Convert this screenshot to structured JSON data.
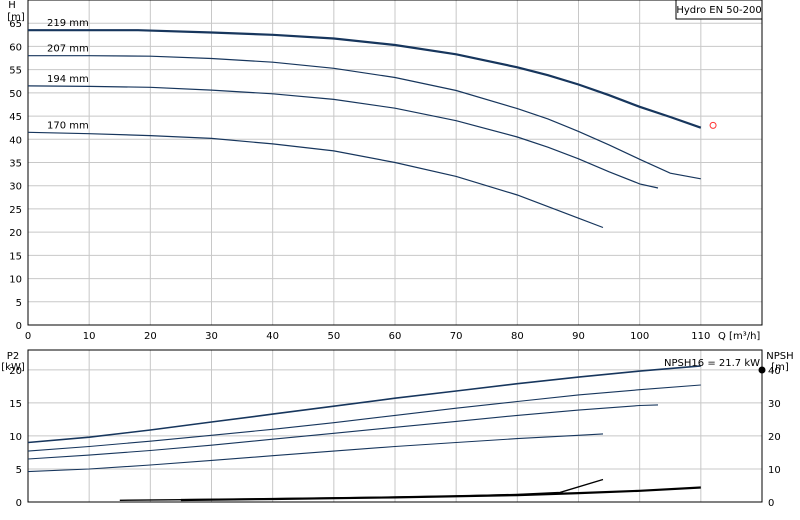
{
  "chart_data": [
    {
      "type": "line",
      "title": "Hydro EN 50-200",
      "ylabel": "H",
      "yunit": "[m]",
      "xlabel": "Q [m³/h]",
      "xlim": [
        0,
        120
      ],
      "ylim": [
        0,
        70
      ],
      "xticks": [
        "0",
        "10",
        "20",
        "30",
        "40",
        "50",
        "60",
        "70",
        "80",
        "90",
        "100",
        "110"
      ],
      "yticks": [
        "0",
        "5",
        "10",
        "15",
        "20",
        "25",
        "30",
        "35",
        "40",
        "45",
        "50",
        "55",
        "60",
        "65"
      ],
      "grid": true,
      "duty_point": {
        "x": 112,
        "y": 43
      },
      "series": [
        {
          "name": "219 mm",
          "emphasis": true,
          "x": [
            0,
            18,
            30,
            40,
            50,
            60,
            70,
            80,
            85,
            90,
            95,
            100,
            105,
            110
          ],
          "y": [
            63.5,
            63.5,
            63.0,
            62.5,
            61.7,
            60.3,
            58.3,
            55.5,
            53.8,
            51.8,
            49.5,
            47.0,
            44.8,
            42.5
          ]
        },
        {
          "name": "207 mm",
          "emphasis": false,
          "x": [
            0,
            10,
            20,
            30,
            40,
            50,
            60,
            70,
            80,
            85,
            90,
            95,
            100,
            105,
            110
          ],
          "y": [
            58.0,
            58.0,
            57.9,
            57.4,
            56.6,
            55.3,
            53.3,
            50.5,
            46.6,
            44.4,
            41.7,
            38.8,
            35.7,
            32.7,
            31.5
          ]
        },
        {
          "name": "194 mm",
          "emphasis": false,
          "x": [
            0,
            10,
            20,
            30,
            40,
            50,
            60,
            70,
            80,
            85,
            90,
            95,
            100,
            103
          ],
          "y": [
            51.5,
            51.4,
            51.2,
            50.6,
            49.8,
            48.6,
            46.7,
            44.0,
            40.5,
            38.3,
            35.8,
            33.0,
            30.4,
            29.5
          ]
        },
        {
          "name": "170 mm",
          "emphasis": false,
          "x": [
            0,
            10,
            20,
            30,
            40,
            50,
            60,
            70,
            80,
            85,
            90,
            94
          ],
          "y": [
            41.5,
            41.2,
            40.8,
            40.2,
            39.0,
            37.5,
            35.0,
            32.0,
            28.0,
            25.5,
            23.0,
            21.0
          ]
        }
      ]
    },
    {
      "type": "line",
      "ylabel": "P2",
      "yunit": "[kW]",
      "y2label": "NPSH",
      "y2unit": "[m]",
      "annotation": "NPSH16 = 21.7 kW",
      "xlim": [
        0,
        120
      ],
      "ylim": [
        0,
        23
      ],
      "y2lim": [
        0,
        46
      ],
      "yticks": [
        "0",
        "5",
        "10",
        "15",
        "20"
      ],
      "y2ticks": [
        "0",
        "10",
        "20",
        "30",
        "40"
      ],
      "grid": true,
      "power_series": [
        {
          "x": [
            0,
            10,
            20,
            30,
            40,
            50,
            60,
            70,
            80,
            90,
            100,
            110
          ],
          "y": [
            9.0,
            9.8,
            10.9,
            12.1,
            13.3,
            14.5,
            15.7,
            16.8,
            17.9,
            18.9,
            19.8,
            20.6
          ]
        },
        {
          "x": [
            0,
            10,
            20,
            30,
            40,
            50,
            60,
            70,
            80,
            90,
            100,
            110
          ],
          "y": [
            7.7,
            8.4,
            9.2,
            10.1,
            11.0,
            12.0,
            13.1,
            14.2,
            15.2,
            16.2,
            17.0,
            17.7
          ]
        },
        {
          "x": [
            0,
            10,
            20,
            30,
            40,
            50,
            60,
            70,
            80,
            90,
            100,
            103
          ],
          "y": [
            6.5,
            7.1,
            7.8,
            8.6,
            9.5,
            10.4,
            11.3,
            12.2,
            13.1,
            13.9,
            14.6,
            14.7
          ]
        },
        {
          "x": [
            0,
            10,
            20,
            30,
            40,
            50,
            60,
            70,
            80,
            90,
            94
          ],
          "y": [
            4.6,
            5.0,
            5.6,
            6.3,
            7.0,
            7.7,
            8.4,
            9.0,
            9.6,
            10.1,
            10.3
          ]
        }
      ],
      "npsh_series": [
        {
          "x": [
            15,
            30,
            50,
            70,
            80,
            87,
            94
          ],
          "y": [
            0.5,
            0.8,
            1.2,
            1.8,
            2.3,
            2.9,
            6.8
          ]
        },
        {
          "x": [
            25,
            40,
            60,
            80,
            90,
            100,
            110
          ],
          "y": [
            0.6,
            0.9,
            1.4,
            2.1,
            2.7,
            3.4,
            4.4
          ]
        }
      ]
    }
  ]
}
